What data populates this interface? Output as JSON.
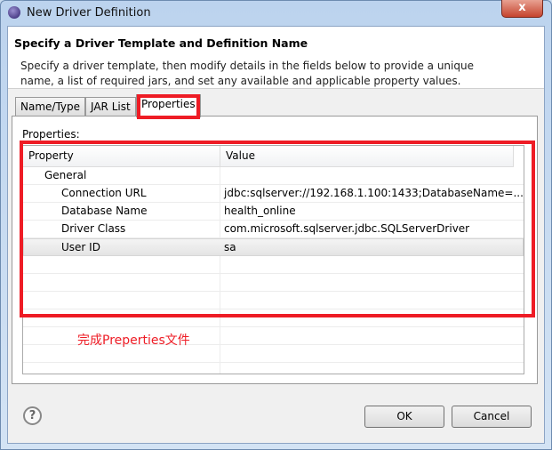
{
  "window": {
    "title": "New Driver Definition",
    "close": "x"
  },
  "header": {
    "title": "Specify a Driver Template and Definition Name",
    "description": "Specify a driver template, then modify details in the fields below to provide a unique name, a list of required jars, and set any available and applicable property values."
  },
  "tabs": [
    {
      "label": "Name/Type"
    },
    {
      "label": "JAR List"
    },
    {
      "label": "Properties",
      "active": true
    }
  ],
  "properties": {
    "label": "Properties:",
    "columns": [
      "Property",
      "Value"
    ],
    "rows": [
      {
        "property": "General",
        "value": ""
      },
      {
        "property": "Connection URL",
        "value": "jdbc:sqlserver://192.168.1.100:1433;DatabaseName=..."
      },
      {
        "property": "Database Name",
        "value": "health_online"
      },
      {
        "property": "Driver Class",
        "value": "com.microsoft.sqlserver.jdbc.SQLServerDriver"
      },
      {
        "property": "User ID",
        "value": "sa"
      }
    ]
  },
  "annotation": "完成Preperties文件",
  "help": "?",
  "buttons": {
    "ok": "OK",
    "cancel": "Cancel"
  },
  "colors": {
    "highlight": "#ee1c25"
  }
}
